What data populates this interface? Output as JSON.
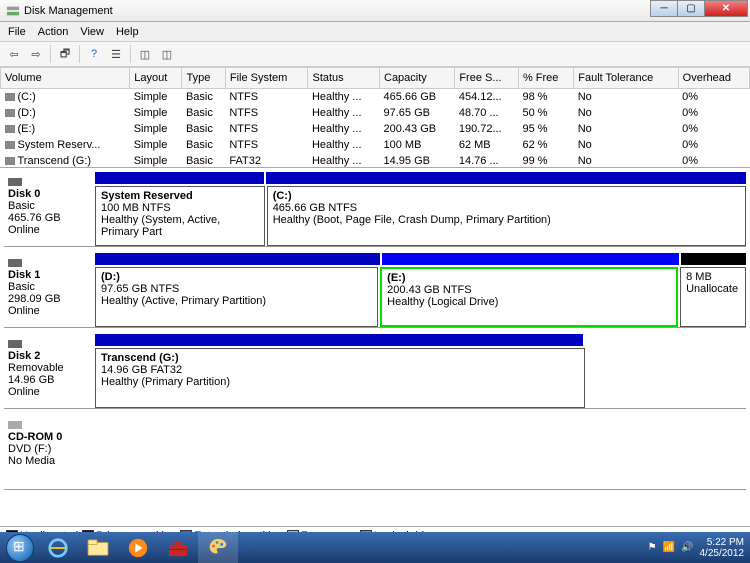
{
  "window": {
    "title": "Disk Management"
  },
  "menu": [
    "File",
    "Action",
    "View",
    "Help"
  ],
  "columns": [
    "Volume",
    "Layout",
    "Type",
    "File System",
    "Status",
    "Capacity",
    "Free S...",
    "% Free",
    "Fault Tolerance",
    "Overhead"
  ],
  "volumes": [
    {
      "name": "(C:)",
      "layout": "Simple",
      "type": "Basic",
      "fs": "NTFS",
      "status": "Healthy ...",
      "capacity": "465.66 GB",
      "free": "454.12...",
      "pct": "98 %",
      "fault": "No",
      "overhead": "0%"
    },
    {
      "name": "(D:)",
      "layout": "Simple",
      "type": "Basic",
      "fs": "NTFS",
      "status": "Healthy ...",
      "capacity": "97.65 GB",
      "free": "48.70 ...",
      "pct": "50 %",
      "fault": "No",
      "overhead": "0%"
    },
    {
      "name": "(E:)",
      "layout": "Simple",
      "type": "Basic",
      "fs": "NTFS",
      "status": "Healthy ...",
      "capacity": "200.43 GB",
      "free": "190.72...",
      "pct": "95 %",
      "fault": "No",
      "overhead": "0%"
    },
    {
      "name": "System Reserv...",
      "layout": "Simple",
      "type": "Basic",
      "fs": "NTFS",
      "status": "Healthy ...",
      "capacity": "100 MB",
      "free": "62 MB",
      "pct": "62 %",
      "fault": "No",
      "overhead": "0%"
    },
    {
      "name": "Transcend (G:)",
      "layout": "Simple",
      "type": "Basic",
      "fs": "FAT32",
      "status": "Healthy ...",
      "capacity": "14.95 GB",
      "free": "14.76 ...",
      "pct": "99 %",
      "fault": "No",
      "overhead": "0%"
    }
  ],
  "disks": [
    {
      "name": "Disk 0",
      "type": "Basic",
      "size": "465.76 GB",
      "state": "Online",
      "parts": [
        {
          "title": "System Reserved",
          "size": "100 MB NTFS",
          "status": "Healthy (System, Active, Primary Part",
          "color": "#0000c0",
          "width": "26%",
          "border": ""
        },
        {
          "title": "(C:)",
          "size": "465.66 GB NTFS",
          "status": "Healthy (Boot, Page File, Crash Dump, Primary Partition)",
          "color": "#0000c0",
          "width": "74%",
          "border": ""
        }
      ]
    },
    {
      "name": "Disk 1",
      "type": "Basic",
      "size": "298.09 GB",
      "state": "Online",
      "parts": [
        {
          "title": "(D:)",
          "size": "97.65 GB NTFS",
          "status": "Healthy (Active, Primary Partition)",
          "color": "#0000c0",
          "width": "44%",
          "border": ""
        },
        {
          "title": "(E:)",
          "size": "200.43 GB NTFS",
          "status": "Healthy (Logical Drive)",
          "color": "#0000ff",
          "width": "46%",
          "border": "green"
        },
        {
          "title": "",
          "size": "8 MB",
          "status": "Unallocate",
          "color": "#000",
          "width": "10%",
          "border": ""
        }
      ]
    },
    {
      "name": "Disk 2",
      "type": "Removable",
      "size": "14.96 GB",
      "state": "Online",
      "parts": [
        {
          "title": "Transcend  (G:)",
          "size": "14.96 GB FAT32",
          "status": "Healthy (Primary Partition)",
          "color": "#0000c0",
          "width": "75%",
          "border": ""
        }
      ]
    },
    {
      "name": "CD-ROM 0",
      "type": "DVD (F:)",
      "size": "",
      "state": "No Media",
      "parts": []
    }
  ],
  "legend": [
    {
      "label": "Unallocated",
      "color": "#000"
    },
    {
      "label": "Primary partition",
      "color": "#0000c0"
    },
    {
      "label": "Extended partition",
      "color": "#00b000"
    },
    {
      "label": "Free space",
      "color": "#80e080"
    },
    {
      "label": "Logical drive",
      "color": "#6080ff"
    }
  ],
  "systray": {
    "time": "5:22 PM",
    "date": "4/25/2012"
  }
}
